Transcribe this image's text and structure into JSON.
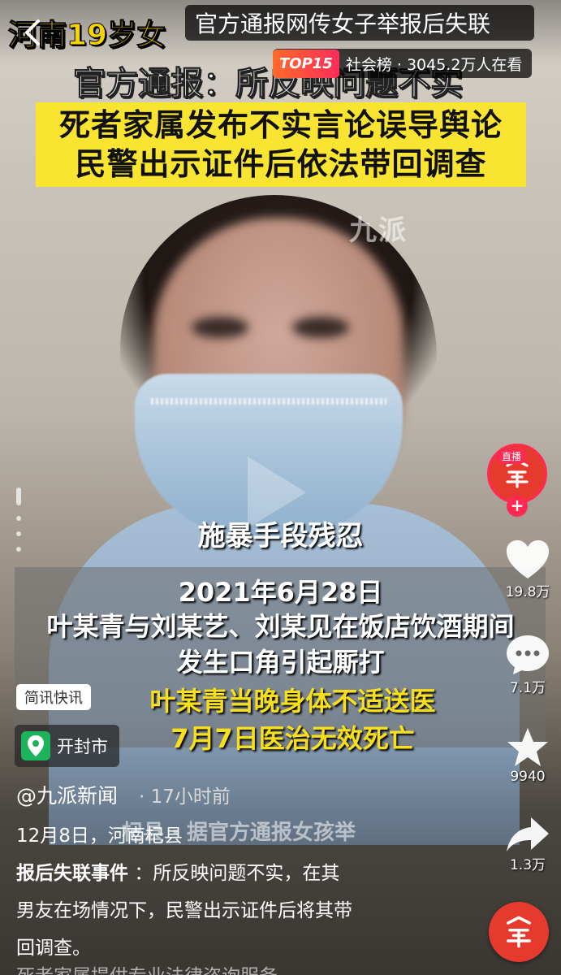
{
  "header": {
    "yellow_headline": "河南19岁女",
    "hashtag": "官方通报网传女子举报后失联",
    "rank_badge": "TOP15",
    "rank_text": "社会榜 · 3045.2万人在看",
    "official_line": "官方通报：所反映问题不实",
    "yellow_box_line1": "死者家属发布不实言论误导舆论",
    "yellow_box_line2": "民警出示证件后依法带回调查"
  },
  "video": {
    "watermark": "九派",
    "caption_cruel": "施暴手段残忍",
    "caption_date": "2021年6月28日",
    "caption_line2": "叶某青与刘某艺、刘某见在饭店饮酒期间",
    "caption_line3": "发生口角引起厮打",
    "caption_yellow1": "叶某青当晚身体不适送医",
    "caption_yellow2": "7月7日医治无效死亡"
  },
  "rail": {
    "live_label": "直播",
    "like_count": "19.8万",
    "comment_count": "7.1万",
    "favorite_count": "9940",
    "share_count": "1.3万"
  },
  "info": {
    "tag": "简讯快讯",
    "location": "开封市",
    "author": "@九派新闻",
    "time": "· 17小时前",
    "desc_line1": "12月8日，河南杞县",
    "desc_overlay": "杞县 · 据官方通报女孩举",
    "desc_bold": "报后失联事件",
    "desc_rest1": "：所反映问题不实，在其",
    "desc_line3": "男友在场情况下，民警出示证件后将其带",
    "desc_line4": "回调查。",
    "desc_cut": "死者家属提供专业法律咨询服务"
  },
  "colors": {
    "headline_yellow": "#f6d400",
    "box_yellow": "#f9e531",
    "caption_yellow": "#f7df1e",
    "live_red": "#ff2a52",
    "location_green": "#1db35a"
  },
  "icons": [
    "back-chevron-icon",
    "heart-icon",
    "comment-icon",
    "star-icon",
    "share-icon",
    "location-pin-icon",
    "play-icon"
  ]
}
